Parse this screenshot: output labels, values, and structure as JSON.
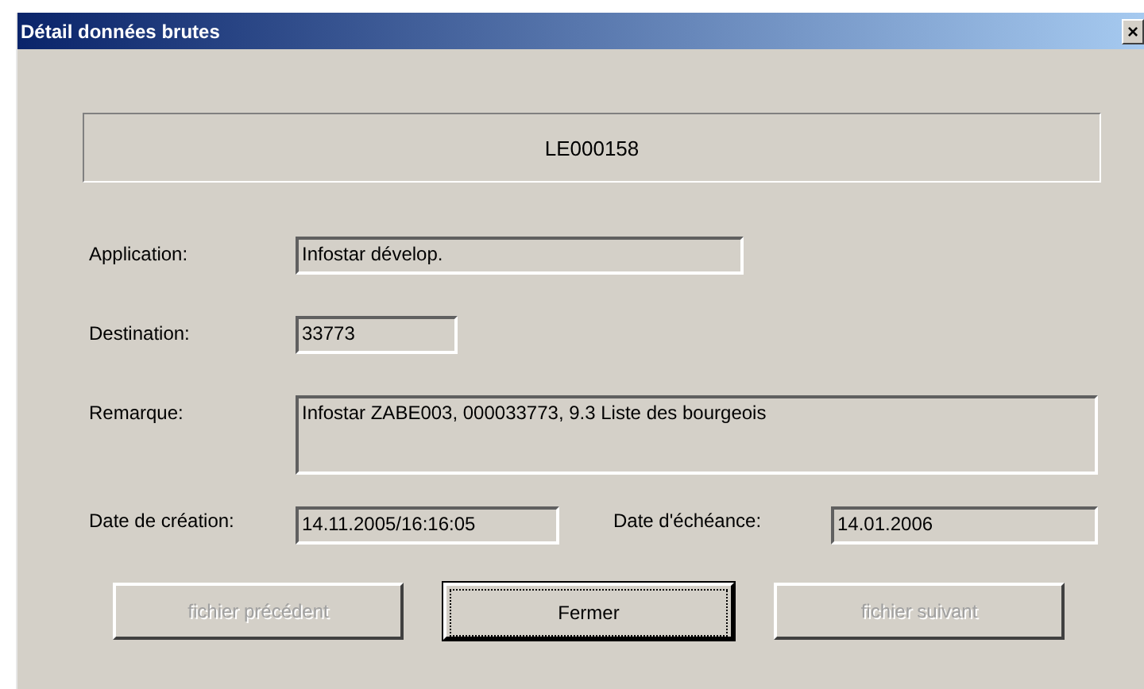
{
  "window": {
    "title": "Détail données brutes",
    "close": "×"
  },
  "record_id": "LE000158",
  "fields": [
    {
      "label": "Application:",
      "value": "Infostar dévelop.",
      "kind": "medium"
    },
    {
      "label": "Destination:",
      "value": "33773",
      "kind": "small"
    },
    {
      "label": "Remarque:",
      "value": "Infostar ZABE003, 000033773, 9.3 Liste des bourgeois",
      "kind": "large"
    }
  ],
  "dates": [
    {
      "label": "Date de création:",
      "value": "14.11.2005/16:16:05"
    },
    {
      "label": "Date d'échéance:",
      "value": "14.01.2006"
    }
  ],
  "buttons": [
    {
      "label": "fichier précédent",
      "disabled": true,
      "focused": false
    },
    {
      "label": "Fermer",
      "disabled": false,
      "focused": true
    },
    {
      "label": "fichier suivant",
      "disabled": true,
      "focused": false
    }
  ]
}
